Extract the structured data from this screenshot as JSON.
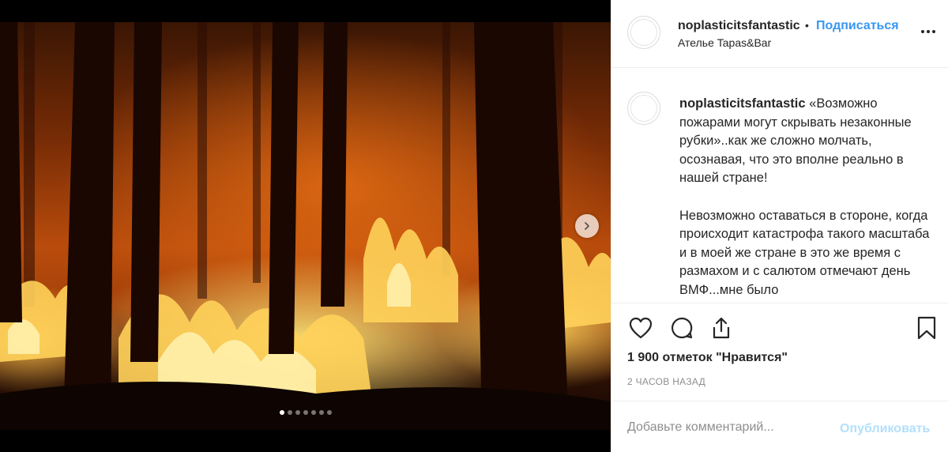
{
  "media": {
    "image_alt": "",
    "carousel": {
      "total": 7,
      "active_index": 0
    },
    "next_icon": "chevron-right-icon"
  },
  "header": {
    "username": "noplasticitsfantastic",
    "separator": "•",
    "follow_label": "Подписаться",
    "location": "Ателье Tapas&Bar",
    "more_icon": "more-options-icon"
  },
  "caption": {
    "username": "noplasticitsfantastic",
    "paragraph_1": "«Возможно пожарами могут скрывать незаконные рубки»..как же сложно молчать, осознавая, что это вполне реально в нашей стране!",
    "paragraph_2": "Невозможно оставаться в стороне, когда происходит катастрофа такого масштаба и в моей же стране в это же время с размахом и с салютом отмечают день ВМФ...мне было"
  },
  "actions": {
    "like_icon": "heart-icon",
    "comment_icon": "comment-icon",
    "share_icon": "share-icon",
    "save_icon": "bookmark-icon"
  },
  "likes_text": "1 900 отметок \"Нравится\"",
  "timestamp": "2 ЧАСОВ НАЗАД",
  "comment_form": {
    "placeholder": "Добавьте комментарий...",
    "publish_label": "Опубликовать"
  },
  "colors": {
    "link_blue": "#3897f0",
    "publish_disabled": "#b2dffc",
    "text": "#262626",
    "muted": "#8e8e8e"
  }
}
